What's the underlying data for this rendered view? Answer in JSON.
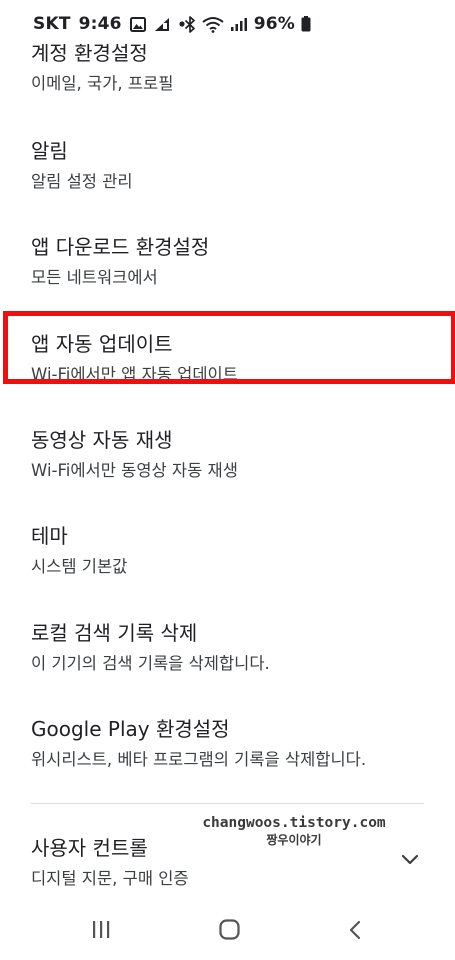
{
  "status_bar": {
    "carrier": "SKT",
    "time": "9:46",
    "battery": "96%",
    "icons": [
      "gallery-icon",
      "network-activity-icon",
      "dot-icon",
      "bluetooth-icon",
      "wifi-icon",
      "signal-icon",
      "battery-icon"
    ]
  },
  "settings": {
    "items": [
      {
        "title": "계정 환경설정",
        "subtitle": "이메일, 국가, 프로필"
      },
      {
        "title": "알림",
        "subtitle": "알림 설정 관리"
      },
      {
        "title": "앱 다운로드 환경설정",
        "subtitle": "모든 네트워크에서"
      },
      {
        "title": "앱 자동 업데이트",
        "subtitle": "Wi-Fi에서만 앱 자동 업데이트"
      },
      {
        "title": "동영상 자동 재생",
        "subtitle": "Wi-Fi에서만 동영상 자동 재생"
      },
      {
        "title": "테마",
        "subtitle": "시스템 기본값"
      },
      {
        "title": "로컬 검색 기록 삭제",
        "subtitle": "이 기기의 검색 기록을 삭제합니다."
      },
      {
        "title": "Google Play 환경설정",
        "subtitle": "위시리스트, 베타 프로그램의 기록을 삭제합니다."
      },
      {
        "title": "사용자 컨트롤",
        "subtitle": "디지털 지문, 구매 인증"
      }
    ]
  },
  "highlight_color": "#ee0f0f",
  "watermark": {
    "line1": "changwoos.tistory.com",
    "line2": "짱우이야기"
  },
  "nav_bar": {
    "icons": [
      "recent-apps-icon",
      "home-icon",
      "back-icon"
    ]
  }
}
